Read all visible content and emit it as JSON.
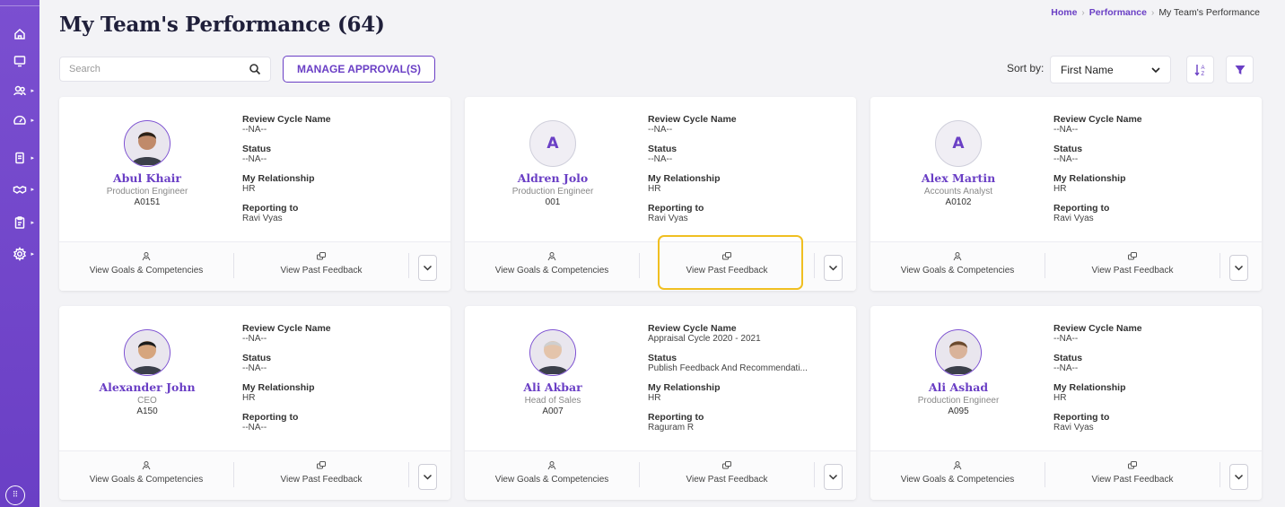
{
  "page": {
    "title": "My Team's Performance (64)"
  },
  "breadcrumb": {
    "home": "Home",
    "performance": "Performance",
    "current": "My Team's Performance"
  },
  "toolbar": {
    "search_placeholder": "Search",
    "manage_label": "MANAGE APPROVAL(S)",
    "sort_label": "Sort by:",
    "sort_value": "First Name"
  },
  "labels": {
    "review_cycle": "Review Cycle Name",
    "status": "Status",
    "relationship": "My Relationship",
    "reporting": "Reporting to",
    "view_goals": "View Goals & Competencies",
    "view_feedback": "View Past Feedback"
  },
  "employees": [
    {
      "name": "Abul Khair",
      "role": "Production Engineer",
      "id": "A0151",
      "avatar": "photo",
      "review_cycle": "--NA--",
      "status": "--NA--",
      "relationship": "HR",
      "reporting_to": "Ravi Vyas"
    },
    {
      "name": "Aldren Jolo",
      "role": "Production Engineer",
      "id": "001",
      "avatar": "A",
      "review_cycle": "--NA--",
      "status": "--NA--",
      "relationship": "HR",
      "reporting_to": "Ravi Vyas"
    },
    {
      "name": "Alex Martin",
      "role": "Accounts Analyst",
      "id": "A0102",
      "avatar": "A",
      "review_cycle": "--NA--",
      "status": "--NA--",
      "relationship": "HR",
      "reporting_to": "Ravi Vyas"
    },
    {
      "name": "Alexander John",
      "role": "CEO",
      "id": "A150",
      "avatar": "photo",
      "review_cycle": "--NA--",
      "status": "--NA--",
      "relationship": "HR",
      "reporting_to": "--NA--"
    },
    {
      "name": "Ali Akbar",
      "role": "Head of Sales",
      "id": "A007",
      "avatar": "photo",
      "review_cycle": "Appraisal Cycle 2020 - 2021",
      "status": "Publish Feedback And Recommendati...",
      "relationship": "HR",
      "reporting_to": "Raguram R"
    },
    {
      "name": "Ali Ashad",
      "role": "Production Engineer",
      "id": "A095",
      "avatar": "photo",
      "review_cycle": "--NA--",
      "status": "--NA--",
      "relationship": "HR",
      "reporting_to": "Ravi Vyas"
    }
  ],
  "colors": {
    "brand": "#6a3fc5",
    "highlight": "#f0bf21"
  }
}
